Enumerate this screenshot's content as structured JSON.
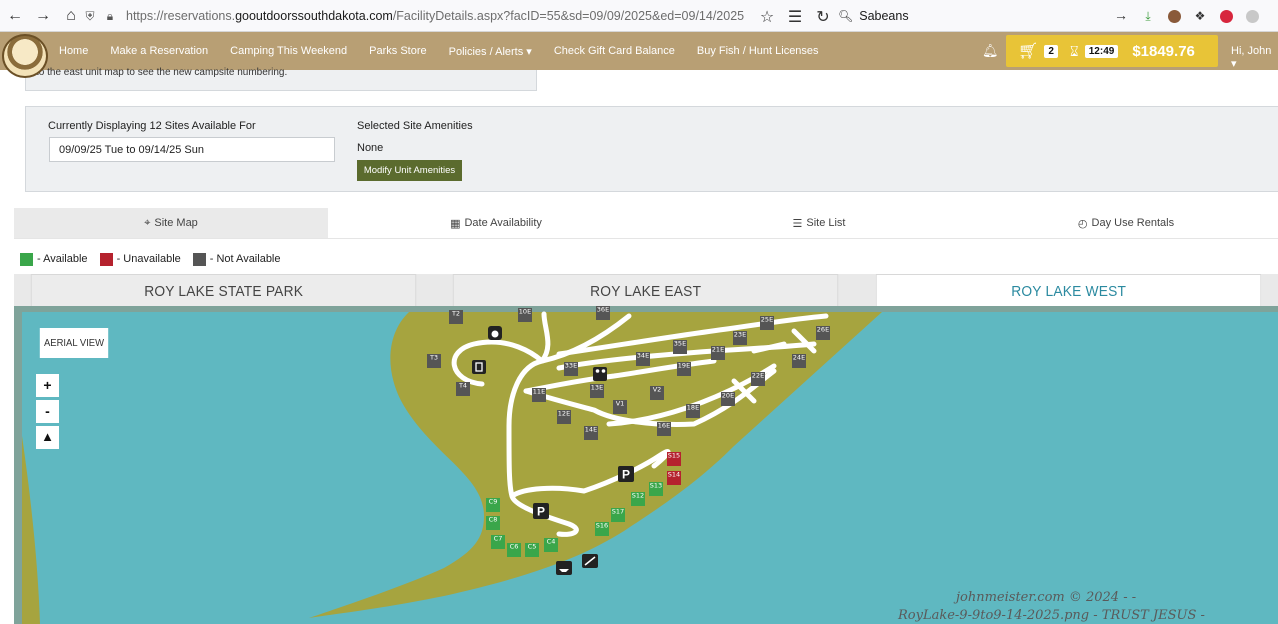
{
  "browser": {
    "url_prefix": "https://reservations.",
    "url_domain": "gooutdoorssouthdakota.com",
    "url_path": "/FacilityDetails.aspx?facID=55&sd=09/09/2025&ed=09/14/2025",
    "search_text": "Sabeans"
  },
  "header": {
    "menu": [
      "Home",
      "Make a Reservation",
      "Camping This Weekend",
      "Parks Store",
      "Policies / Alerts ▾",
      "Check Gift Card Balance",
      "Buy Fish / Hunt Licenses"
    ],
    "cart_count": "2",
    "timer": "12:49",
    "total": "$1849.76",
    "user": "Hi, John ▾"
  },
  "notice_text": "to the east unit map to see the new campsite numbering.",
  "search_panel": {
    "displaying_label": "Currently Displaying 12 Sites Available For",
    "date_range": "09/09/25 Tue to 09/14/25 Sun",
    "amenities_label": "Selected Site Amenities",
    "amenities_value": "None",
    "modify_button": "Modify Unit Amenities"
  },
  "view_tabs": [
    {
      "label": "Site Map",
      "icon": "pin-icon"
    },
    {
      "label": "Date Availability",
      "icon": "calendar-icon"
    },
    {
      "label": "Site List",
      "icon": "list-icon"
    },
    {
      "label": "Day Use Rentals",
      "icon": "clock-icon"
    }
  ],
  "legend": [
    {
      "label": "- Available",
      "color": "#3aa64a"
    },
    {
      "label": "- Unavailable",
      "color": "#b5222e"
    },
    {
      "label": "- Not Available",
      "color": "#555555"
    }
  ],
  "area_tabs": [
    "ROY LAKE STATE PARK",
    "ROY LAKE EAST",
    "ROY LAKE WEST"
  ],
  "map": {
    "aerial_button": "AERIAL VIEW",
    "zoom_in": "+",
    "zoom_out": "-",
    "sites": [
      {
        "label": "T2",
        "status": "not"
      },
      {
        "label": "10E",
        "status": "not"
      },
      {
        "label": "36E",
        "status": "not"
      },
      {
        "label": "25E",
        "status": "not"
      },
      {
        "label": "26E",
        "status": "not"
      },
      {
        "label": "23E",
        "status": "not"
      },
      {
        "label": "T3",
        "status": "not"
      },
      {
        "label": "33E",
        "status": "not"
      },
      {
        "label": "34E",
        "status": "not"
      },
      {
        "label": "35E",
        "status": "not"
      },
      {
        "label": "21E",
        "status": "not"
      },
      {
        "label": "24E",
        "status": "not"
      },
      {
        "label": "T4",
        "status": "not"
      },
      {
        "label": "13E",
        "status": "not"
      },
      {
        "label": "19E",
        "status": "not"
      },
      {
        "label": "22E",
        "status": "not"
      },
      {
        "label": "11E",
        "status": "not"
      },
      {
        "label": "V1",
        "status": "not"
      },
      {
        "label": "V2",
        "status": "not"
      },
      {
        "label": "20E",
        "status": "not"
      },
      {
        "label": "12E",
        "status": "not"
      },
      {
        "label": "18E",
        "status": "not"
      },
      {
        "label": "14E",
        "status": "not"
      },
      {
        "label": "16E",
        "status": "not"
      },
      {
        "label": "S15",
        "status": "unavail"
      },
      {
        "label": "S14",
        "status": "unavail"
      },
      {
        "label": "S13",
        "status": "avail"
      },
      {
        "label": "S12",
        "status": "avail"
      },
      {
        "label": "C9",
        "status": "avail"
      },
      {
        "label": "S17",
        "status": "avail"
      },
      {
        "label": "C8",
        "status": "avail"
      },
      {
        "label": "S16",
        "status": "avail"
      },
      {
        "label": "C7",
        "status": "avail"
      },
      {
        "label": "C4",
        "status": "avail"
      },
      {
        "label": "C6",
        "status": "avail"
      },
      {
        "label": "C5",
        "status": "avail"
      }
    ],
    "parking_label": "P"
  },
  "watermark": {
    "line1": "johnmeister.com  ©  2024  -  -",
    "line2": "RoyLake-9-9to9-14-2025.png  - TRUST JESUS -"
  },
  "colors": {
    "header": "#b89f74",
    "cart": "#e8c437",
    "water": "#5fb8c1",
    "land": "#a6a43f",
    "road": "#ffffff",
    "available": "#3aa64a",
    "unavailable": "#b5222e",
    "not_available": "#555555"
  }
}
